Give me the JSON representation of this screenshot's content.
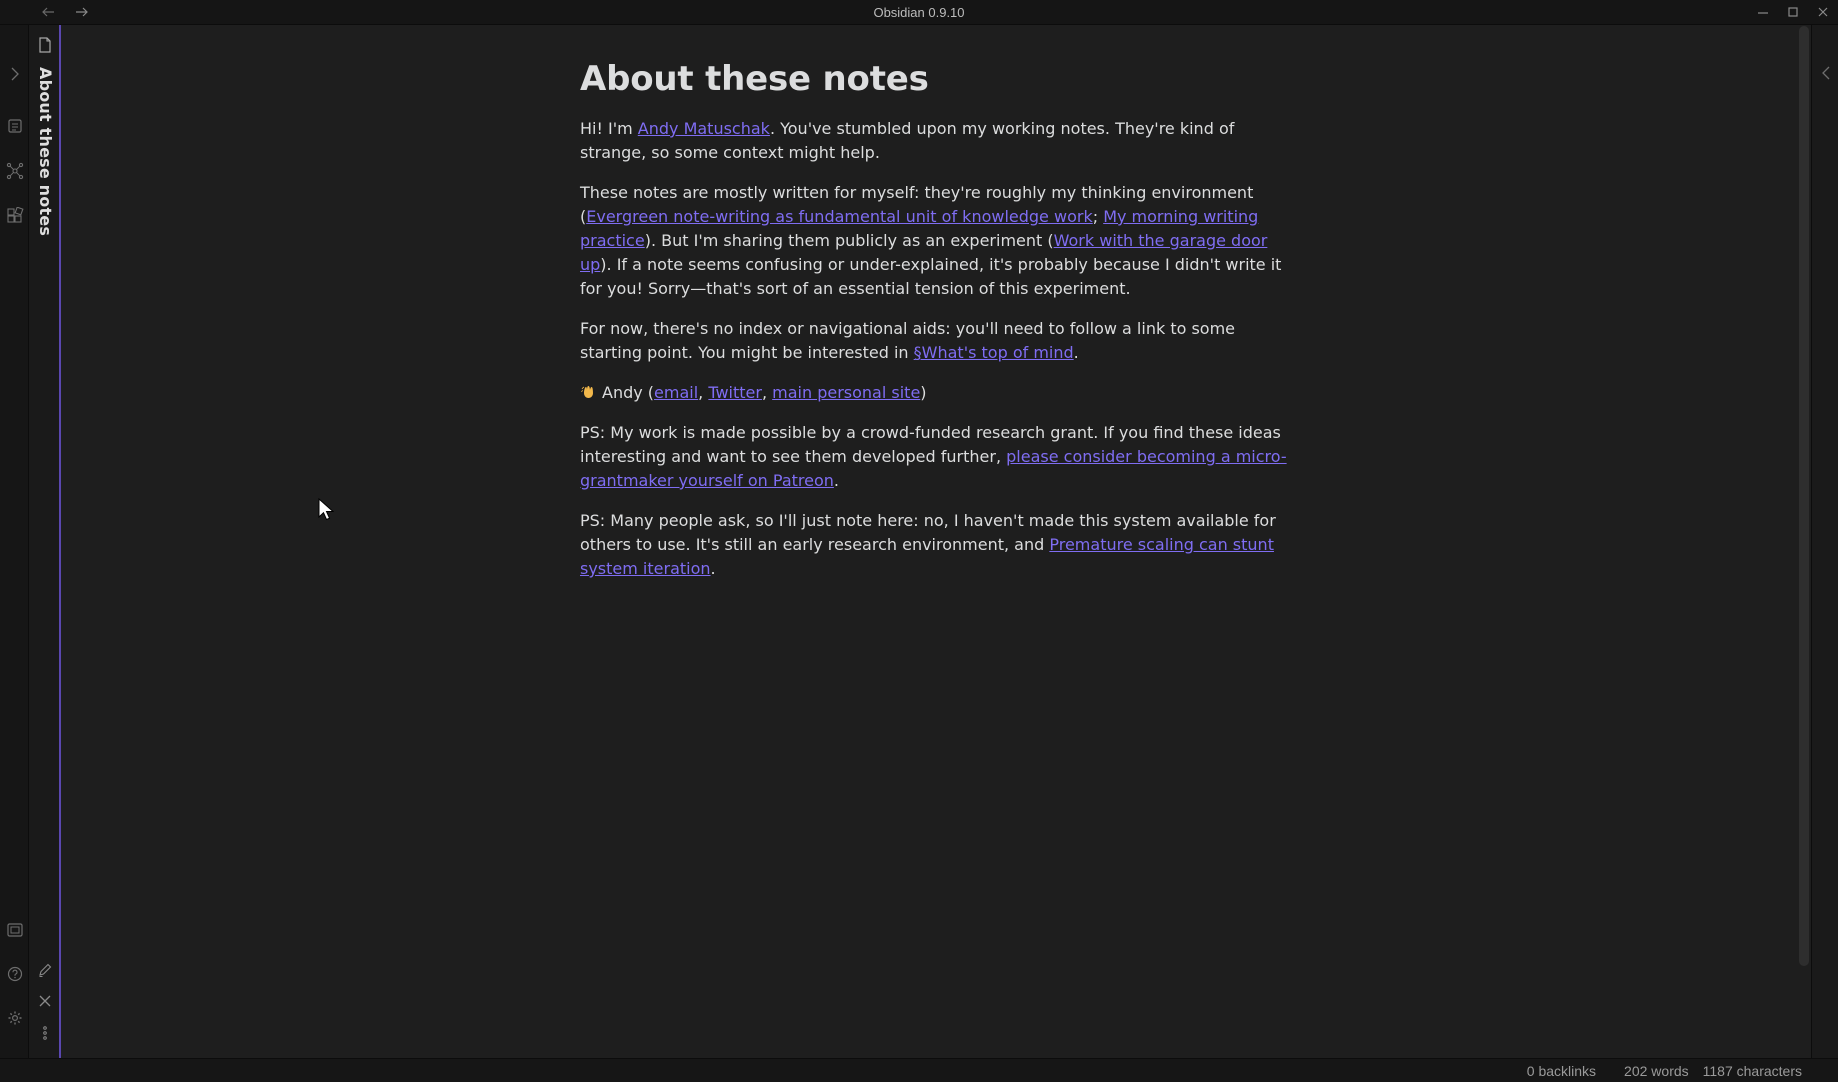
{
  "window": {
    "title": "Obsidian 0.9.10"
  },
  "sidebar": {
    "tab_title": "About these notes"
  },
  "note": {
    "title": "About these notes",
    "p1": {
      "t1": "Hi! I'm ",
      "link1": "Andy Matuschak",
      "t2": ". You've stumbled upon my working notes. They're kind of strange, so some context might help."
    },
    "p2": {
      "t1": "These notes are mostly written for myself: they're roughly my thinking environment (",
      "link1": "Evergreen note-writing as fundamental unit of knowledge work",
      "t2": "; ",
      "link2": "My morning writing practice",
      "t3": "). But I'm sharing them publicly as an experiment (",
      "link3": "Work with the garage door up",
      "t4": "). If a note seems confusing or under-explained, it's probably because I didn't write it for you! Sorry—that's sort of an essential tension of this experiment."
    },
    "p3": {
      "t1": "For now, there's no index or navigational aids: you'll need to follow a link to some starting point. You might be interested in ",
      "link1": "§What's top of mind",
      "t2": "."
    },
    "p4": {
      "t1": "Andy (",
      "link1": "email",
      "t2": ", ",
      "link2": "Twitter",
      "t3": ", ",
      "link3": "main personal site",
      "t4": ")"
    },
    "p5": {
      "t1": "PS: My work is made possible by a crowd-funded research grant. If you find these ideas interesting and want to see them developed further, ",
      "link1": "please consider becoming a micro-grantmaker yourself on Patreon",
      "t2": "."
    },
    "p6": {
      "t1": "PS: Many people ask, so I'll just note here: no, I haven't made this system available for others to use. It's still an early research environment, and ",
      "link1": "Premature scaling can stunt system iteration",
      "t2": "."
    }
  },
  "status": {
    "backlinks": "0 backlinks",
    "words": "202 words",
    "characters": "1187 characters"
  },
  "colors": {
    "accent": "#7f6df2",
    "active_border": "#5a47b0",
    "background": "#1e1e1e"
  }
}
